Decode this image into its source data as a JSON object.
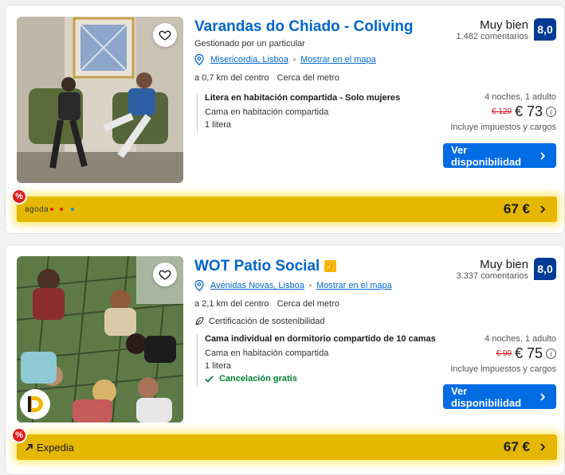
{
  "listings": [
    {
      "title": "Varandas do Chiado - Coliving",
      "managed": "Gestionado por un particular",
      "district": "Misericordia, Lisboa",
      "map_link": "Mostrar en el mapa",
      "distance": "a 0,7 km del centro",
      "metro": "Cerca del metro",
      "room_title": "Litera en habitación compartida - Solo mujeres",
      "room_type": "Cama en habitación compartida",
      "bed": "1 litera",
      "score_label": "Muy bien",
      "reviews": "1.482 comentarios",
      "score": "8,0",
      "nights": "4 noches, 1 adulto",
      "old_price": "€ 120",
      "price": "€ 73",
      "taxes": "Incluye impuestos y cargos",
      "cta": "Ver disponibilidad",
      "deal_provider": "agoda",
      "deal_price": "67 €",
      "pct": "%"
    },
    {
      "title": "WOT Patio Social",
      "district": "Avenidas Novas, Lisboa",
      "map_link": "Mostrar en el mapa",
      "distance": "a 2,1 km del centro",
      "metro": "Cerca del metro",
      "sustainability": "Certificación de sostenibilidad",
      "room_title": "Cama individual en dormitorio compartido de 10 camas",
      "room_type": "Cama en habitación compartida",
      "bed": "1 litera",
      "cancel": "Cancelación gratis",
      "score_label": "Muy bien",
      "reviews": "3.337 comentarios",
      "score": "8,0",
      "nights": "4 noches, 1 adulto",
      "old_price": "€ 90",
      "price": "€ 75",
      "taxes": "Incluye impuestos y cargos",
      "cta": "Ver disponibilidad",
      "deal_provider": "Expedia",
      "deal_price": "67 €",
      "pct": "%"
    }
  ],
  "icons": {
    "heart": "heart-icon",
    "pin": "map-pin-icon",
    "chevron": "chevron-right-icon",
    "leaf": "sustainability-icon",
    "check": "check-icon",
    "info": "info-icon",
    "thumbs": "thumbs-up-icon"
  },
  "colors": {
    "link": "#0066cc",
    "cta": "#006ce4",
    "badge": "#003b95",
    "deal": "#e5b700",
    "strike": "#d4111e",
    "cancel": "#008234"
  }
}
